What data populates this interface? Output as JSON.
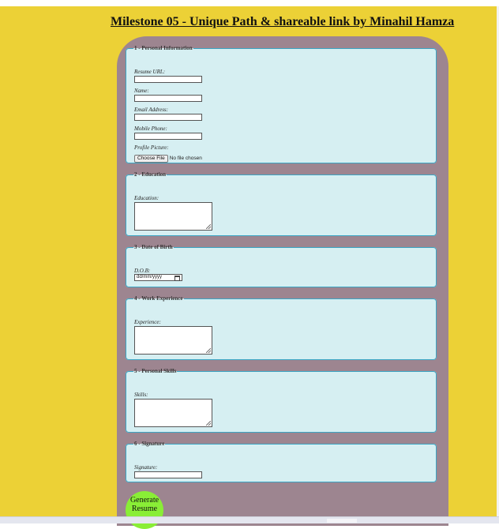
{
  "header": {
    "title": "Milestone 05 - Unique Path & shareable link by Minahil Hamza"
  },
  "sections": {
    "personal": {
      "legend": "1 - Personal Information",
      "resume_url_label": "Resume URL:",
      "name_label": "Name:",
      "email_label": "Email Address:",
      "phone_label": "Mobile Phone:",
      "picture_label": "Profile Picture:",
      "choose_file": "Choose File",
      "no_file": "No file chosen"
    },
    "education": {
      "legend": "2 - Education",
      "label": "Education:"
    },
    "dob": {
      "legend": "3 - Date of Birth",
      "label": "D.O.B:",
      "placeholder": "dd/mm/yyyy"
    },
    "experience": {
      "legend": "4 - Work Experience",
      "label": "Experience:"
    },
    "skills": {
      "legend": "5 - Personal Skills",
      "label": "Skills:"
    },
    "signature": {
      "legend": "6 - Signature",
      "label": "Signature:"
    }
  },
  "generate_button": {
    "label_line1": "Generate",
    "label_line2": "Resume"
  },
  "colors": {
    "page_background": "#ecd136",
    "container": "#9d8590",
    "section_background": "#d6eff2",
    "section_border": "#3ba5c4",
    "generate_button": "#89ee36"
  }
}
